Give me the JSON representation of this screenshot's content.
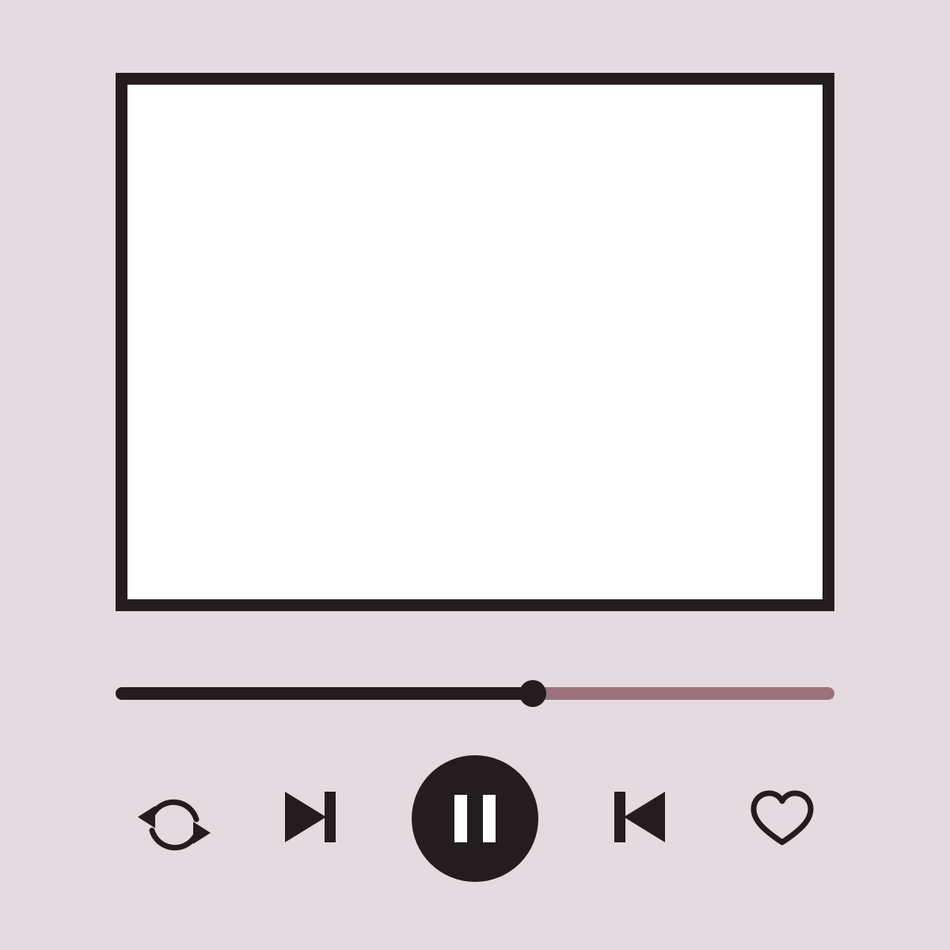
{
  "player": {
    "progress_fraction": 0.58,
    "state": "playing",
    "colors": {
      "background": "#e3dbdf",
      "frame": "#231d20",
      "screen": "#ffffff",
      "played": "#231d20",
      "remaining": "#9b727d"
    }
  },
  "controls": [
    {
      "id": "repeat",
      "icon": "repeat-icon"
    },
    {
      "id": "next",
      "icon": "skip-next-icon"
    },
    {
      "id": "pause",
      "icon": "pause-icon"
    },
    {
      "id": "previous",
      "icon": "skip-previous-icon"
    },
    {
      "id": "favorite",
      "icon": "heart-icon"
    }
  ]
}
